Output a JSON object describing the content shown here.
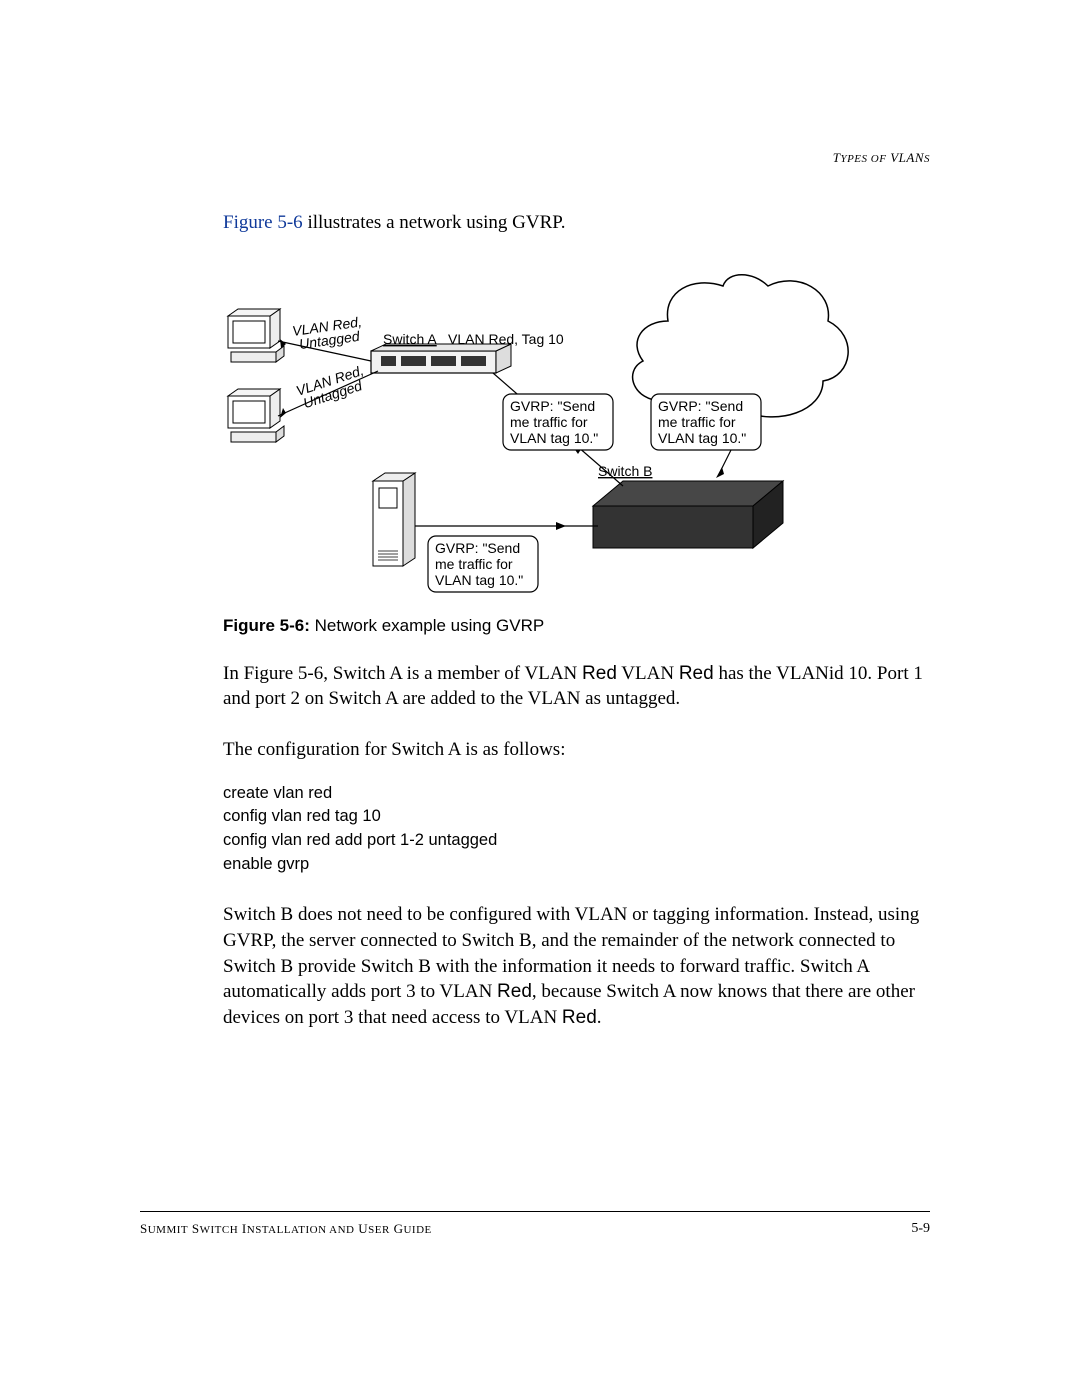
{
  "header": {
    "section": "Types of VLANs"
  },
  "intro": {
    "link": "Figure 5-6",
    "rest": " illustrates a network using GVRP."
  },
  "diagram": {
    "vlan_red_untagged_1": "VLAN Red, Untagged",
    "vlan_red_untagged_2": "VLAN Red, Untagged",
    "switch_a": "Switch A",
    "vlan_red_tag10": "VLAN Red, Tag 10",
    "switch_b": "Switch B",
    "gvrp_msg_l1": "GVRP: \"Send",
    "gvrp_msg_l2": "me traffic for",
    "gvrp_msg_l3": "VLAN tag 10.\""
  },
  "caption": {
    "bold": "Figure 5-6:",
    "rest": "  Network example using GVRP"
  },
  "para1": {
    "t1": "In Figure 5-6, Switch A is a member of VLAN ",
    "red1": "Red",
    "t2": ". VLAN ",
    "red2": "Red",
    "t3": " has the VLANid 10. Port 1 and port 2 on Switch A are added to the VLAN as untagged."
  },
  "para2": "The configuration for Switch A is as follows:",
  "code": "create vlan red\nconfig vlan red tag 10\nconfig vlan red add port 1-2 untagged\nenable gvrp",
  "para3": {
    "t1": "Switch B does not need to be configured with VLAN or tagging information. Instead, using GVRP, the server connected to Switch B, and the remainder of the network connected to Switch B provide Switch B with the information it needs to forward traffic. Switch A automatically adds port 3 to VLAN ",
    "red1": "Red",
    "t2": ", because Switch A now knows that there are other devices on port 3 that need access to VLAN ",
    "red2": "Red",
    "t3": "."
  },
  "footer": {
    "left": "Summit Switch Installation and User Guide",
    "right": "5-9"
  }
}
